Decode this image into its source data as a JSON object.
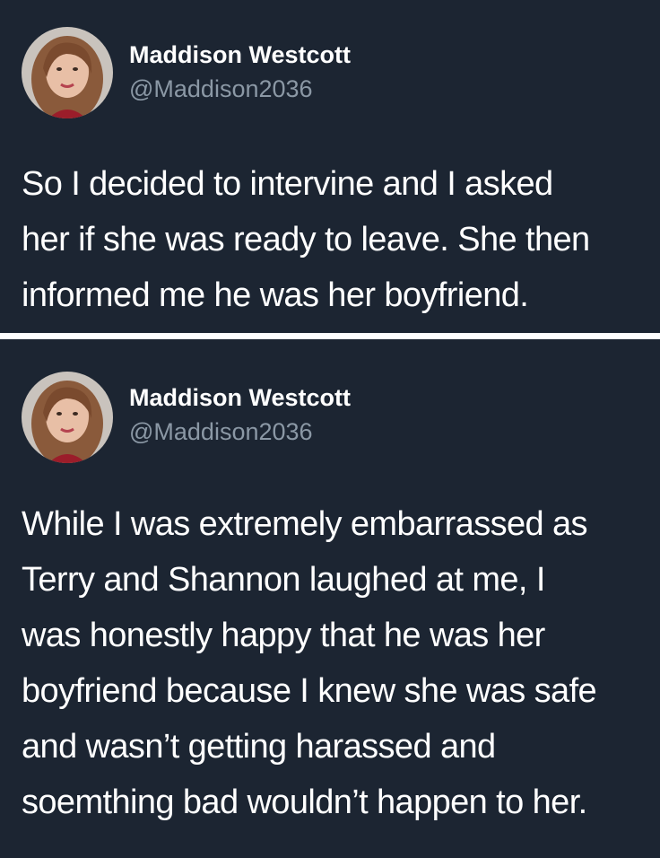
{
  "tweets": [
    {
      "author": {
        "name": "Maddison Westcott",
        "handle": "@Maddison2036",
        "avatar_icon": "profile-photo"
      },
      "text": "So I decided to intervine and I asked\nher if she was ready to leave. She then\ninformed me he was her boyfriend."
    },
    {
      "author": {
        "name": "Maddison Westcott",
        "handle": "@Maddison2036",
        "avatar_icon": "profile-photo"
      },
      "text": "While I was extremely embarrassed as\nTerry and Shannon laughed at me, I\nwas honestly happy that he was her\nboyfriend because I knew she was safe\nand wasn’t getting harassed and\nsoemthing bad wouldn’t happen to her."
    }
  ],
  "colors": {
    "background": "#1c2532",
    "divider": "#ffffff",
    "name_text": "#ffffff",
    "handle_text": "#8b98a5",
    "body_text": "#ffffff"
  }
}
